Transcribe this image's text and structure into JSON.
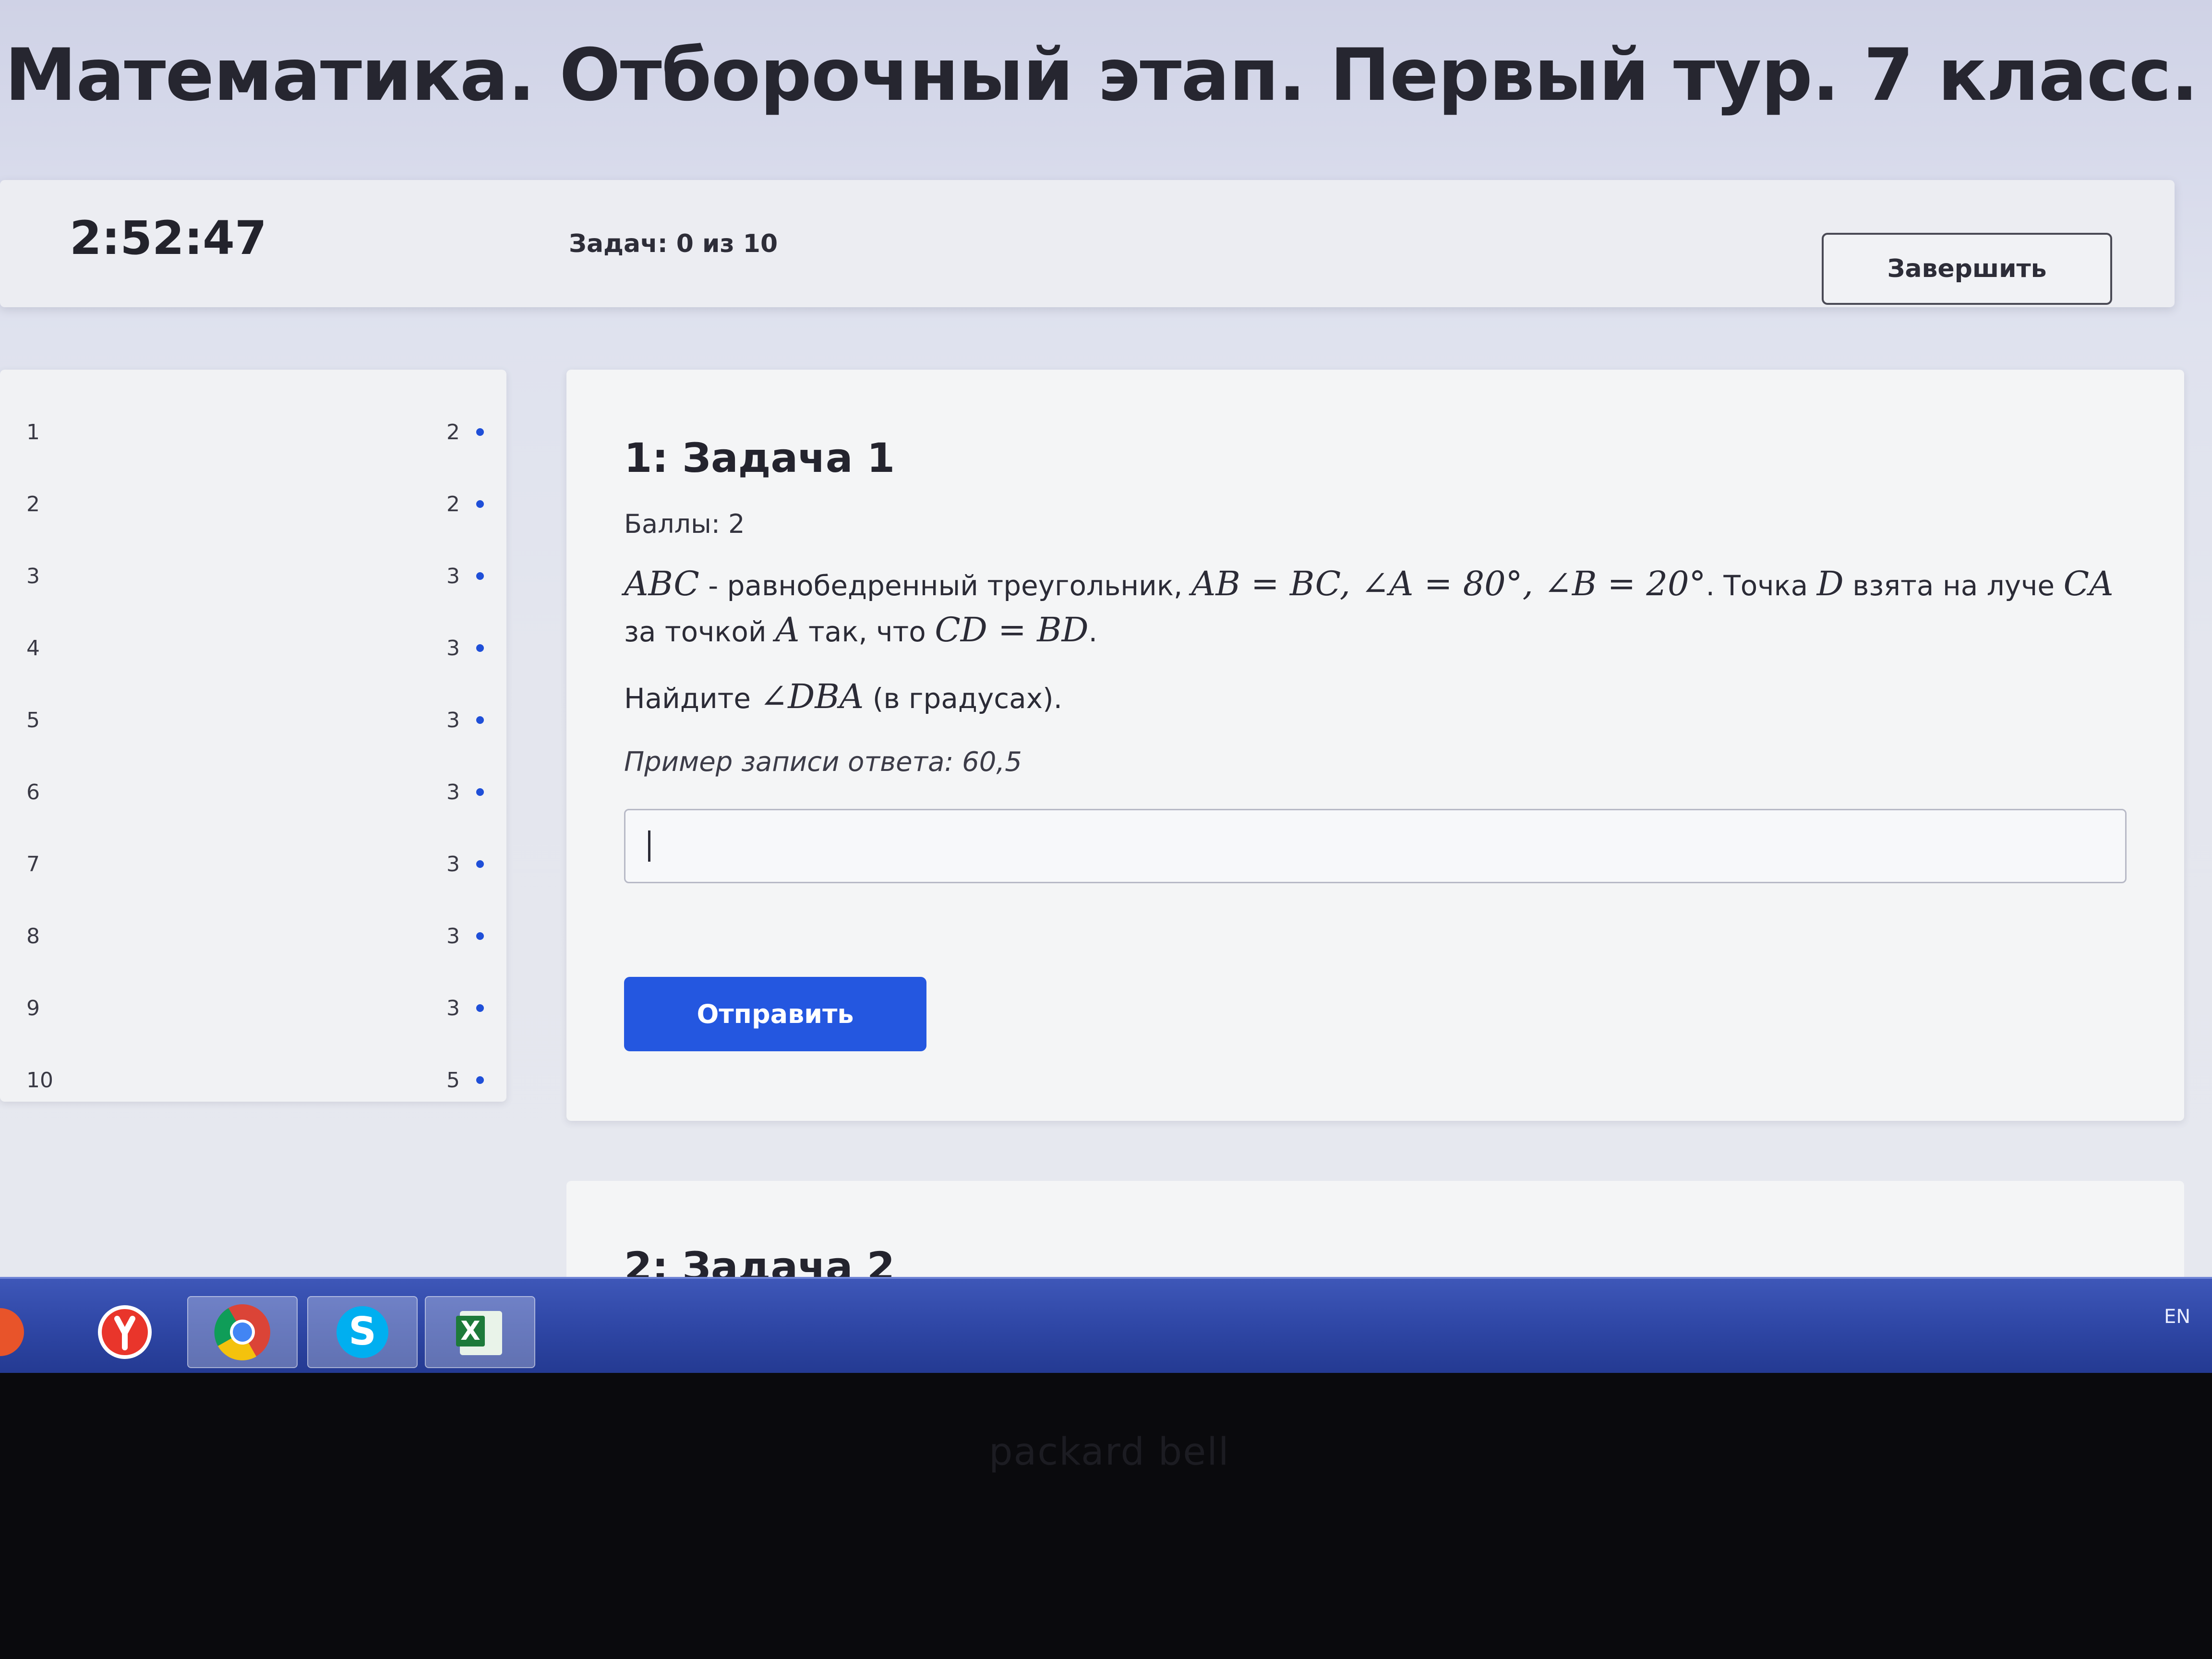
{
  "page": {
    "title": "Математика. Отборочный этап. Первый тур. 7 класс."
  },
  "topbar": {
    "timer": "2:52:47",
    "tasks_count": "Задач: 0 из 10",
    "finish_label": "Завершить"
  },
  "sidebar": {
    "items": [
      {
        "num": "1",
        "points": "2"
      },
      {
        "num": "2",
        "points": "2"
      },
      {
        "num": "3",
        "points": "3"
      },
      {
        "num": "4",
        "points": "3"
      },
      {
        "num": "5",
        "points": "3"
      },
      {
        "num": "6",
        "points": "3"
      },
      {
        "num": "7",
        "points": "3"
      },
      {
        "num": "8",
        "points": "3"
      },
      {
        "num": "9",
        "points": "3"
      },
      {
        "num": "10",
        "points": "5"
      }
    ]
  },
  "task": {
    "title": "1: Задача 1",
    "points": "Баллы: 2",
    "statement": {
      "t1": "ABC",
      "t2": " - равнобедренный треугольник, ",
      "t3": "AB = BC, ∠A = 80°, ∠B = 20°",
      "t4": ". Точка ",
      "t5": "D",
      "t6": " взята на луче ",
      "t7": "CA",
      "t8": " за точкой ",
      "t9": "A",
      "t10": " так, что ",
      "t11": "CD = BD",
      "t12": "."
    },
    "question": {
      "q1": "Найдите ",
      "q2": "∠DBA",
      "q3": " (в градусах)."
    },
    "hint": "Пример записи ответа: 60,5",
    "answer_value": "",
    "submit_label": "Отправить"
  },
  "next_task": {
    "title": "2: Задача 2"
  },
  "taskbar": {
    "apps": [
      "yandex-browser-icon",
      "chrome-icon",
      "skype-icon",
      "excel-icon"
    ],
    "language": "EN"
  },
  "colors": {
    "accent": "#2457e0",
    "dot": "#1f4fd8",
    "taskbar": "#2f47a6"
  }
}
